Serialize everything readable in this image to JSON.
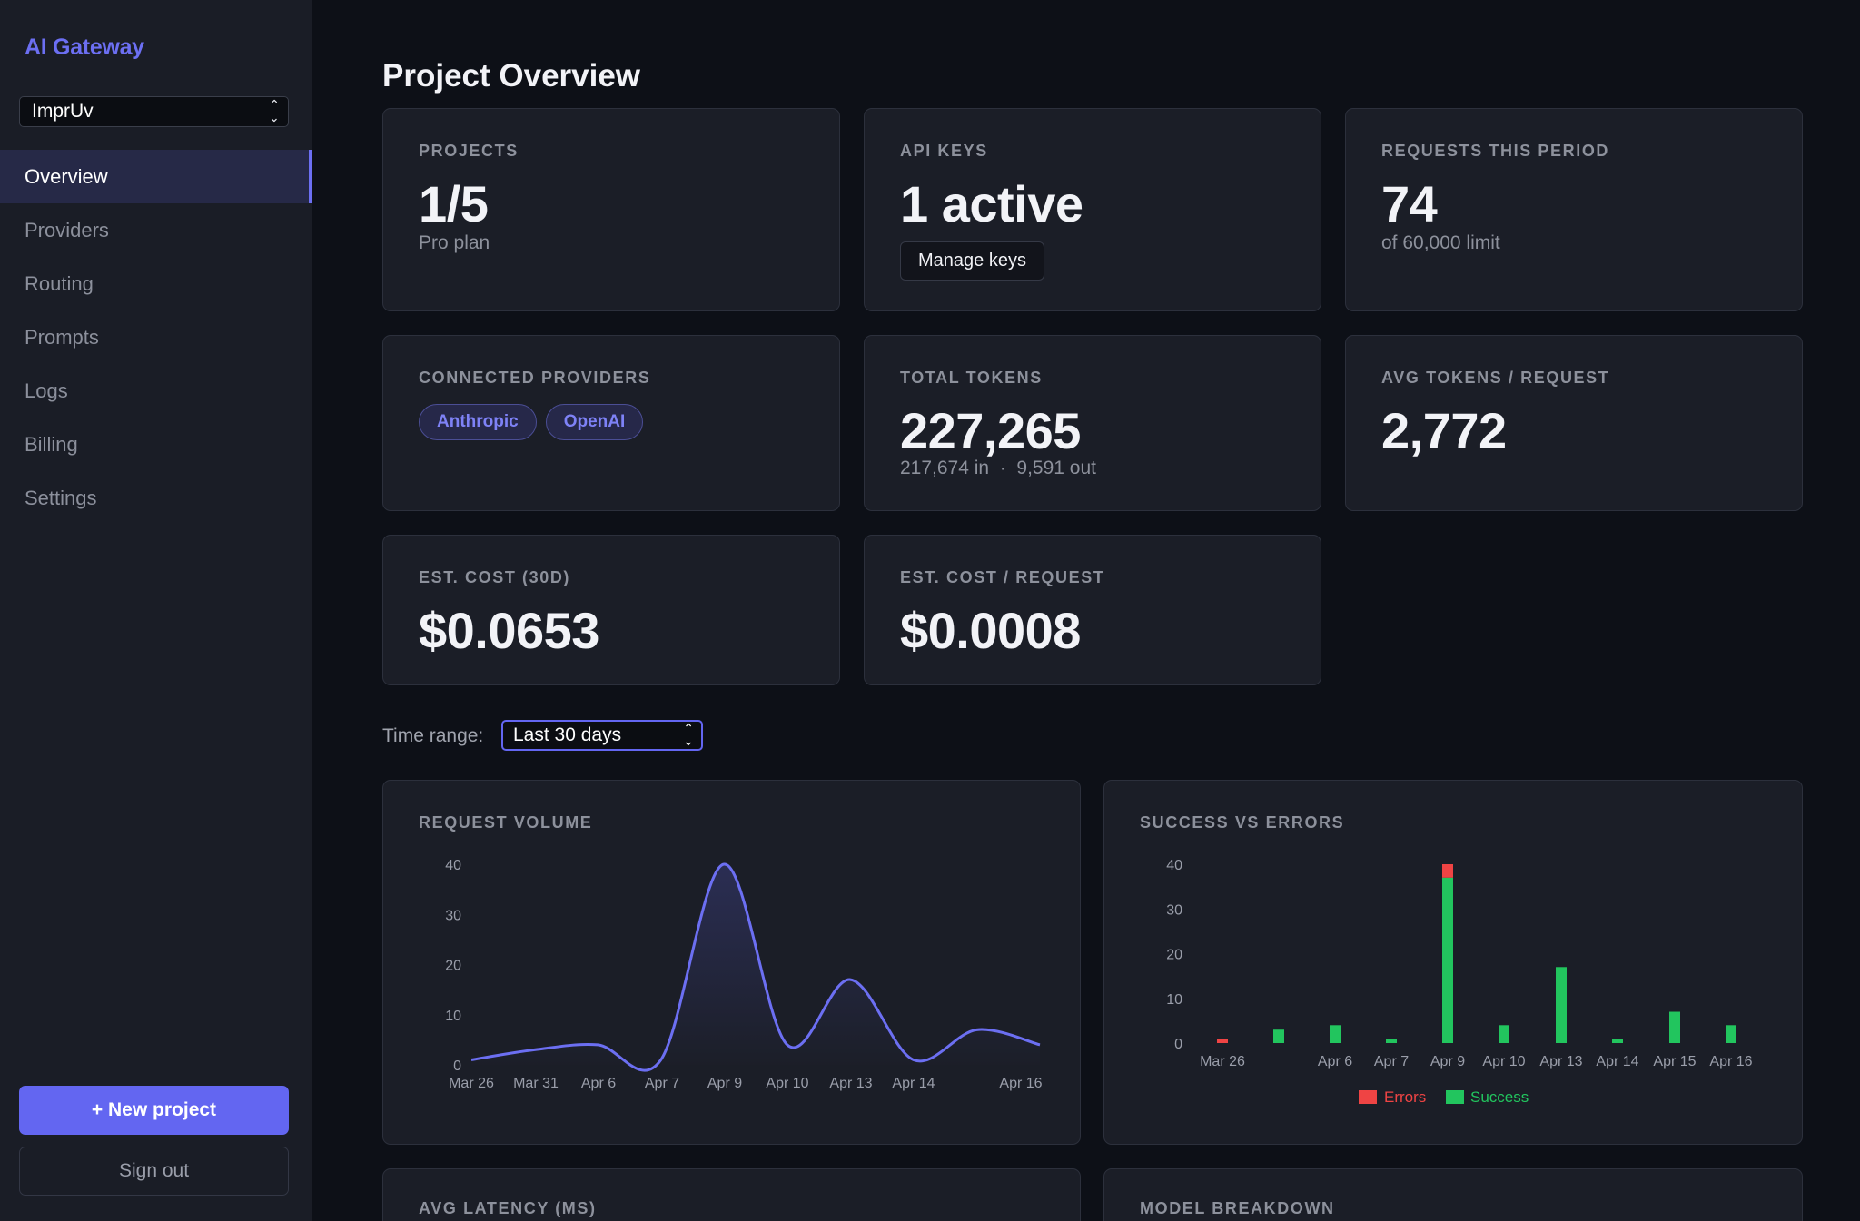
{
  "sidebar": {
    "brand": "AI Gateway",
    "project_select": "ImprUv",
    "nav": [
      {
        "label": "Overview",
        "active": true
      },
      {
        "label": "Providers",
        "active": false
      },
      {
        "label": "Routing",
        "active": false
      },
      {
        "label": "Prompts",
        "active": false
      },
      {
        "label": "Logs",
        "active": false
      },
      {
        "label": "Billing",
        "active": false
      },
      {
        "label": "Settings",
        "active": false
      }
    ],
    "new_project_label": "+ New project",
    "sign_out_label": "Sign out"
  },
  "page_title": "Project Overview",
  "cards": {
    "projects": {
      "label": "PROJECTS",
      "value": "1/5",
      "sub": "Pro plan"
    },
    "api_keys": {
      "label": "API KEYS",
      "value": "1 active",
      "button": "Manage keys"
    },
    "requests": {
      "label": "REQUESTS THIS PERIOD",
      "value": "74",
      "sub": "of 60,000 limit"
    },
    "providers": {
      "label": "CONNECTED PROVIDERS",
      "items": [
        "Anthropic",
        "OpenAI"
      ]
    },
    "total_tokens": {
      "label": "TOTAL TOKENS",
      "value": "227,265",
      "sub": "217,674 in  ·  9,591 out"
    },
    "avg_tokens": {
      "label": "AVG TOKENS / REQUEST",
      "value": "2,772"
    },
    "est_cost": {
      "label": "EST. COST (30D)",
      "value": "$0.0653"
    },
    "est_cost_req": {
      "label": "EST. COST / REQUEST",
      "value": "$0.0008"
    }
  },
  "time_range": {
    "label": "Time range:",
    "value": "Last 30 days"
  },
  "sections": {
    "avg_latency": "AVG LATENCY (MS)",
    "model_breakdown": "MODEL BREAKDOWN"
  },
  "colors": {
    "accent": "#6366f1",
    "success": "#22c55e",
    "error": "#ef4444",
    "line": "#6c6ff2"
  },
  "chart_data": [
    {
      "type": "line",
      "title": "REQUEST VOLUME",
      "x": [
        "Mar 26",
        "Mar 31",
        "Apr 6",
        "Apr 7",
        "Apr 9",
        "Apr 10",
        "Apr 13",
        "Apr 14",
        "Apr 16"
      ],
      "tick_labels_x": [
        "Mar 26",
        "Mar 31",
        "Apr 6",
        "Apr 7",
        "Apr 9",
        "Apr 10",
        "Apr 13",
        "Apr 14",
        "Apr 16"
      ],
      "values": [
        1,
        3,
        4,
        1,
        40,
        4,
        17,
        1,
        7,
        4
      ],
      "yticks": [
        0,
        10,
        20,
        30,
        40
      ],
      "ylim": [
        0,
        40
      ]
    },
    {
      "type": "bar",
      "title": "SUCCESS VS ERRORS",
      "categories": [
        "Mar 26",
        "",
        "Apr 6",
        "Apr 7",
        "Apr 9",
        "Apr 10",
        "Apr 13",
        "Apr 14",
        "Apr 15",
        "Apr 16"
      ],
      "series": [
        {
          "name": "Errors",
          "values": [
            1,
            0,
            0,
            0,
            3,
            0,
            0,
            0,
            0,
            0
          ]
        },
        {
          "name": "Success",
          "values": [
            0,
            3,
            4,
            1,
            37,
            4,
            17,
            1,
            7,
            4
          ]
        }
      ],
      "yticks": [
        0,
        10,
        20,
        30,
        40
      ],
      "ylim": [
        0,
        40
      ],
      "stacked": true,
      "legend": "bottom-center"
    }
  ]
}
